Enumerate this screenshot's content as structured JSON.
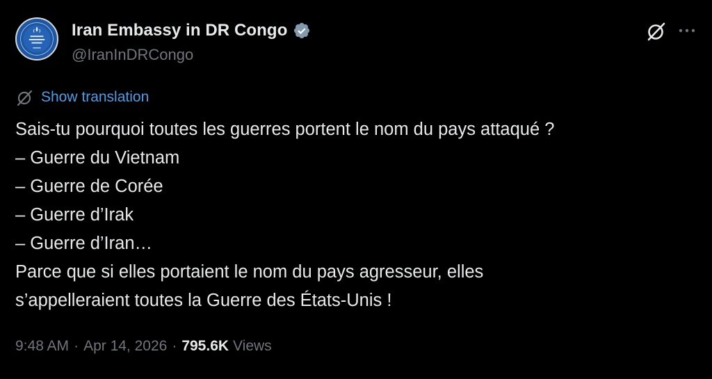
{
  "author": {
    "display_name": "Iran Embassy in DR Congo",
    "handle": "@IranInDRCongo",
    "verified": true,
    "verified_color": "#829aab",
    "avatar_icon": "embassy-seal-icon"
  },
  "header_actions": {
    "grok_icon": "grok-icon",
    "more_icon": "more-icon"
  },
  "translation": {
    "label": "Show translation",
    "icon": "translate-icon",
    "link_color": "#4a9ee8"
  },
  "tweet": {
    "lines": [
      "Sais-tu pourquoi toutes les guerres portent le nom du pays attaqué ?",
      "– Guerre du Vietnam",
      "– Guerre de Corée",
      "– Guerre d’Irak",
      "– Guerre d’Iran…",
      "Parce que si elles portaient le nom du pays agresseur, elles",
      "s’appelleraient toutes la Guerre des États-Unis !"
    ]
  },
  "meta": {
    "time": "9:48 AM",
    "separator": "·",
    "date": "Apr 14, 2026",
    "views_count": "795.6K",
    "views_label": "Views"
  }
}
